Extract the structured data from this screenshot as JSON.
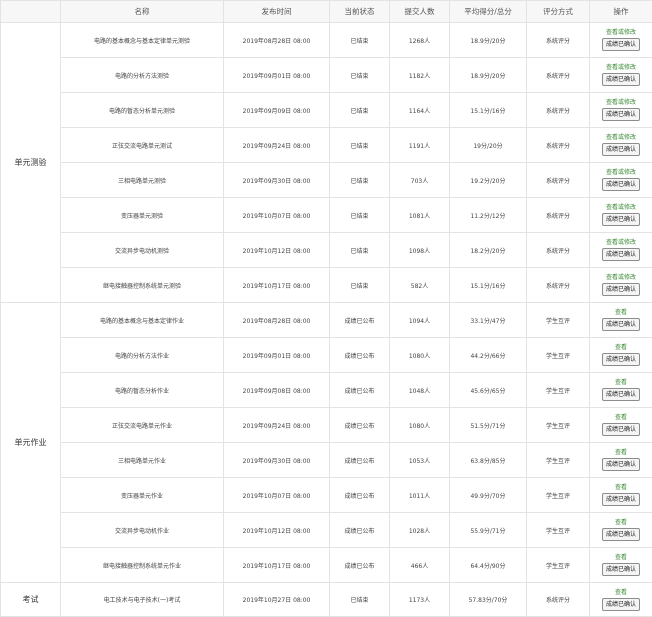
{
  "headers": {
    "name": "名称",
    "time": "发布时间",
    "status": "当前状态",
    "count": "提交人数",
    "score": "平均得分/总分",
    "method": "评分方式",
    "op": "操作"
  },
  "groups": [
    {
      "category": "单元测验",
      "rows": [
        {
          "name": "电路的基本概念与基本定律单元测验",
          "time": "2019年08月28日 08:00",
          "status": "已结束",
          "count": "1268人",
          "score": "18.9分/20分",
          "method": "系统评分",
          "link": "查看或修改",
          "button": "成绩已确认"
        },
        {
          "name": "电路的分析方法测验",
          "time": "2019年09月01日 08:00",
          "status": "已结束",
          "count": "1182人",
          "score": "18.9分/20分",
          "method": "系统评分",
          "link": "查看或修改",
          "button": "成绩已确认"
        },
        {
          "name": "电路的暂态分析单元测验",
          "time": "2019年09月09日 08:00",
          "status": "已结束",
          "count": "1164人",
          "score": "15.1分/16分",
          "method": "系统评分",
          "link": "查看或修改",
          "button": "成绩已确认"
        },
        {
          "name": "正弦交流电路单元测试",
          "time": "2019年09月24日 08:00",
          "status": "已结束",
          "count": "1191人",
          "score": "19分/20分",
          "method": "系统评分",
          "link": "查看或修改",
          "button": "成绩已确认"
        },
        {
          "name": "三相电路单元测验",
          "time": "2019年09月30日 08:00",
          "status": "已结束",
          "count": "703人",
          "score": "19.2分/20分",
          "method": "系统评分",
          "link": "查看或修改",
          "button": "成绩已确认"
        },
        {
          "name": "变压器单元测验",
          "time": "2019年10月07日 08:00",
          "status": "已结束",
          "count": "1081人",
          "score": "11.2分/12分",
          "method": "系统评分",
          "link": "查看或修改",
          "button": "成绩已确认"
        },
        {
          "name": "交流异步电动机测验",
          "time": "2019年10月12日 08:00",
          "status": "已结束",
          "count": "1098人",
          "score": "18.2分/20分",
          "method": "系统评分",
          "link": "查看或修改",
          "button": "成绩已确认"
        },
        {
          "name": "继电接触器控制系统单元测验",
          "time": "2019年10月17日 08:00",
          "status": "已结束",
          "count": "582人",
          "score": "15.1分/16分",
          "method": "系统评分",
          "link": "查看或修改",
          "button": "成绩已确认"
        }
      ]
    },
    {
      "category": "单元作业",
      "rows": [
        {
          "name": "电路的基本概念与基本定律作业",
          "time": "2019年08月28日 08:00",
          "status": "成绩已公布",
          "count": "1094人",
          "score": "33.1分/47分",
          "method": "学生互评",
          "link": "查看",
          "button": "成绩已确认"
        },
        {
          "name": "电路的分析方法作业",
          "time": "2019年09月01日 08:00",
          "status": "成绩已公布",
          "count": "1080人",
          "score": "44.2分/66分",
          "method": "学生互评",
          "link": "查看",
          "button": "成绩已确认"
        },
        {
          "name": "电路的暂态分析作业",
          "time": "2019年09月08日 08:00",
          "status": "成绩已公布",
          "count": "1048人",
          "score": "45.6分/65分",
          "method": "学生互评",
          "link": "查看",
          "button": "成绩已确认"
        },
        {
          "name": "正弦交流电路单元作业",
          "time": "2019年09月24日 08:00",
          "status": "成绩已公布",
          "count": "1080人",
          "score": "51.5分/71分",
          "method": "学生互评",
          "link": "查看",
          "button": "成绩已确认"
        },
        {
          "name": "三相电路单元作业",
          "time": "2019年09月30日 08:00",
          "status": "成绩已公布",
          "count": "1053人",
          "score": "63.8分/85分",
          "method": "学生互评",
          "link": "查看",
          "button": "成绩已确认"
        },
        {
          "name": "变压器单元作业",
          "time": "2019年10月07日 08:00",
          "status": "成绩已公布",
          "count": "1011人",
          "score": "49.9分/70分",
          "method": "学生互评",
          "link": "查看",
          "button": "成绩已确认"
        },
        {
          "name": "交流异步电动机作业",
          "time": "2019年10月12日 08:00",
          "status": "成绩已公布",
          "count": "1028人",
          "score": "55.9分/71分",
          "method": "学生互评",
          "link": "查看",
          "button": "成绩已确认"
        },
        {
          "name": "继电接触器控制系统单元作业",
          "time": "2019年10月17日 08:00",
          "status": "成绩已公布",
          "count": "466人",
          "score": "64.4分/90分",
          "method": "学生互评",
          "link": "查看",
          "button": "成绩已确认"
        }
      ]
    },
    {
      "category": "考试",
      "rows": [
        {
          "name": "电工技术与电子技术(一)考试",
          "time": "2019年10月27日 08:00",
          "status": "已结束",
          "count": "1173人",
          "score": "57.83分/70分",
          "method": "系统评分",
          "link": "查看",
          "button": "成绩已确认"
        }
      ]
    }
  ]
}
